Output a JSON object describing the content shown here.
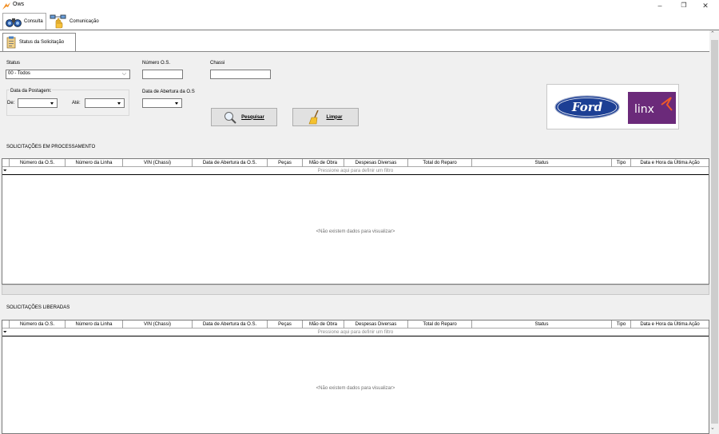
{
  "window": {
    "title": "Ows",
    "minimize": "–",
    "maximize": "❐",
    "close": "✕"
  },
  "topnav": {
    "items": [
      {
        "label": "Consulta",
        "icon": "binoculars-icon"
      },
      {
        "label": "Comunicação",
        "icon": "hand-network-icon"
      }
    ]
  },
  "tab": {
    "label": "Status da Solicitação",
    "icon": "clipboard-icon"
  },
  "filters": {
    "status_label": "Status",
    "status_value": "00 - Todos",
    "numero_os_label": "Número O.S.",
    "numero_os_value": "",
    "chassi_label": "Chassi",
    "chassi_value": "",
    "data_postagem_label": "Data da Postagem:",
    "de_label": "De:",
    "ate_label": "Até:",
    "data_abertura_label": "Data de Abertura da O.S",
    "pesquisar_label": "Pesquisar",
    "limpar_label": "Limpar"
  },
  "logos": {
    "ford": "Ford",
    "linx": "linx"
  },
  "processing": {
    "title": "SOLICITAÇÕES EM PROCESSAMENTO",
    "filter_hint": "Pressione aqui para definir um filtro",
    "empty": "<Não existem dados para visualizar>"
  },
  "released": {
    "title": "SOLICITAÇÕES LIBERADAS",
    "filter_hint": "Pressione aqui para definir um filtro",
    "empty": "<Não existem dados para visualizar>"
  },
  "columns": [
    "Número da O.S.",
    "Número da Linha",
    "VIN (Chassi)",
    "Data de Abertura da O.S.",
    "Peças",
    "Mão de Obra",
    "Despesas Diversas",
    "Total do Reparo",
    "Status",
    "Tipo",
    "Data e Hora da Última Ação"
  ],
  "colors": {
    "accent": "#f28c1e",
    "ford_blue": "#1c3f94",
    "linx_purple": "#6b2a7a"
  }
}
